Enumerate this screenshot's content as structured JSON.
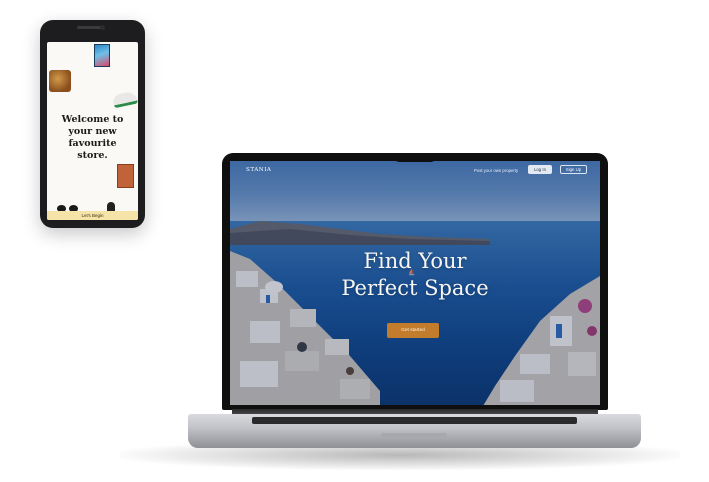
{
  "phone": {
    "title": "Welcome to\nyour new\nfavourite\nstore.",
    "cta_label": "Let's Begin"
  },
  "laptop": {
    "nav": {
      "logo": "STANIA",
      "list_link": "Post your own property",
      "login_label": "Log In",
      "signup_label": "Sign Up"
    },
    "hero": {
      "title": "Find Your\nPerfect Space",
      "cta_label": "Get started"
    }
  },
  "colors": {
    "accent": "#c27c2c",
    "phone_bar": "#f5e3a8",
    "sea": "#1f5ea8"
  }
}
